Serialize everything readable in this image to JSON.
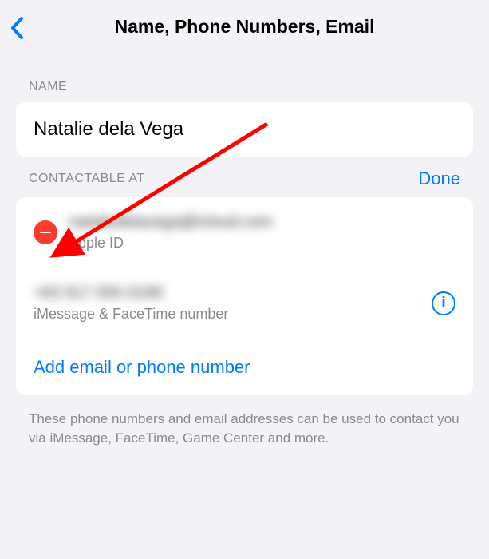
{
  "header": {
    "title": "Name, Phone Numbers, Email"
  },
  "sections": {
    "name": {
      "label": "NAME",
      "value": "Natalie dela Vega"
    },
    "contactable": {
      "label": "CONTACTABLE AT",
      "done": "Done",
      "items": [
        {
          "sub": "Apple ID"
        },
        {
          "sub": "iMessage & FaceTime number"
        }
      ],
      "add": "Add email or phone number"
    }
  },
  "footer": "These phone numbers and email addresses can be used to contact you via iMessage, FaceTime, Game Center and more.",
  "info_glyph": "i"
}
